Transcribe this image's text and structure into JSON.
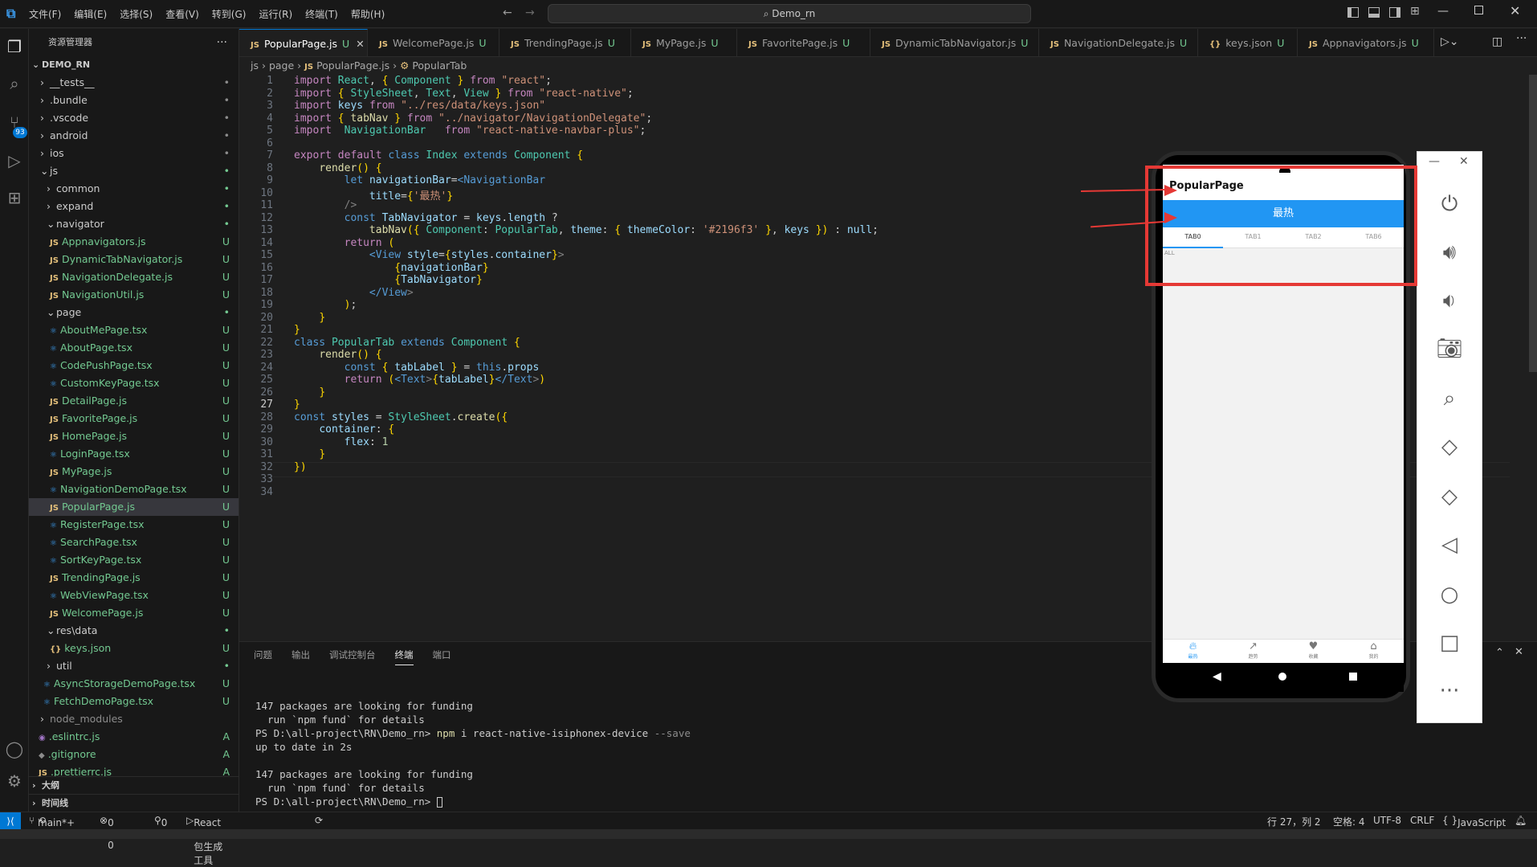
{
  "menu": [
    "文件(F)",
    "编辑(E)",
    "选择(S)",
    "查看(V)",
    "转到(G)",
    "运行(R)",
    "终端(T)",
    "帮助(H)"
  ],
  "search": {
    "text": "Demo_rn"
  },
  "sidebar": {
    "title": "资源管理器",
    "root": "DEMO_RN",
    "items": [
      {
        "label": "__tests__",
        "type": "folder",
        "status": "•"
      },
      {
        "label": ".bundle",
        "type": "folder",
        "status": "•"
      },
      {
        "label": ".vscode",
        "type": "folder",
        "status": "•"
      },
      {
        "label": "android",
        "type": "folder",
        "status": "•"
      },
      {
        "label": "ios",
        "type": "folder",
        "status": "•"
      },
      {
        "label": "js",
        "type": "folder-open",
        "status": "•"
      },
      {
        "label": "common",
        "type": "folder",
        "status": "•"
      },
      {
        "label": "expand",
        "type": "folder",
        "status": "•"
      },
      {
        "label": "navigator",
        "type": "folder-open",
        "status": "•"
      },
      {
        "label": "Appnavigators.js",
        "type": "js",
        "status": "U"
      },
      {
        "label": "DynamicTabNavigator.js",
        "type": "js",
        "status": "U"
      },
      {
        "label": "NavigationDelegate.js",
        "type": "js",
        "status": "U"
      },
      {
        "label": "NavigationUtil.js",
        "type": "js",
        "status": "U"
      },
      {
        "label": "page",
        "type": "folder-open",
        "status": "•"
      },
      {
        "label": "AboutMePage.tsx",
        "type": "tsx",
        "status": "U"
      },
      {
        "label": "AboutPage.tsx",
        "type": "tsx",
        "status": "U"
      },
      {
        "label": "CodePushPage.tsx",
        "type": "tsx",
        "status": "U"
      },
      {
        "label": "CustomKeyPage.tsx",
        "type": "tsx",
        "status": "U"
      },
      {
        "label": "DetailPage.js",
        "type": "js",
        "status": "U"
      },
      {
        "label": "FavoritePage.js",
        "type": "js",
        "status": "U"
      },
      {
        "label": "HomePage.js",
        "type": "js",
        "status": "U"
      },
      {
        "label": "LoginPage.tsx",
        "type": "tsx",
        "status": "U"
      },
      {
        "label": "MyPage.js",
        "type": "js",
        "status": "U"
      },
      {
        "label": "NavigationDemoPage.tsx",
        "type": "tsx",
        "status": "U"
      },
      {
        "label": "PopularPage.js",
        "type": "js",
        "status": "U"
      },
      {
        "label": "RegisterPage.tsx",
        "type": "tsx",
        "status": "U"
      },
      {
        "label": "SearchPage.tsx",
        "type": "tsx",
        "status": "U"
      },
      {
        "label": "SortKeyPage.tsx",
        "type": "tsx",
        "status": "U"
      },
      {
        "label": "TrendingPage.js",
        "type": "js",
        "status": "U"
      },
      {
        "label": "WebViewPage.tsx",
        "type": "tsx",
        "status": "U"
      },
      {
        "label": "WelcomePage.js",
        "type": "js",
        "status": "U"
      },
      {
        "label": "res\\data",
        "type": "folder-open",
        "status": "•"
      },
      {
        "label": "keys.json",
        "type": "json",
        "status": "U"
      },
      {
        "label": "util",
        "type": "folder",
        "status": "•"
      },
      {
        "label": "AsyncStorageDemoPage.tsx",
        "type": "tsx",
        "status": "U"
      },
      {
        "label": "FetchDemoPage.tsx",
        "type": "tsx",
        "status": "U"
      },
      {
        "label": "node_modules",
        "type": "folder",
        "status": ""
      },
      {
        "label": ".eslintrc.js",
        "type": "eslint",
        "status": "A"
      },
      {
        "label": ".gitignore",
        "type": "git",
        "status": "A"
      },
      {
        "label": ".prettierrc.js",
        "type": "prettier",
        "status": "A"
      }
    ],
    "outline": "大纲",
    "timeline": "时间线"
  },
  "tabs": [
    {
      "label": "PopularPage.js",
      "status": "U",
      "active": true
    },
    {
      "label": "WelcomePage.js",
      "status": "U"
    },
    {
      "label": "TrendingPage.js",
      "status": "U"
    },
    {
      "label": "MyPage.js",
      "status": "U"
    },
    {
      "label": "FavoritePage.js",
      "status": "U"
    },
    {
      "label": "DynamicTabNavigator.js",
      "status": "U"
    },
    {
      "label": "NavigationDelegate.js",
      "status": "U"
    },
    {
      "label": "keys.json",
      "status": "U"
    },
    {
      "label": "Appnavigators.js",
      "status": "U"
    }
  ],
  "breadcrumb": {
    "p1": "js",
    "p2": "page",
    "p3": "PopularPage.js",
    "p4": "PopularTab"
  },
  "code": [
    "import React, { Component } from \"react\";",
    "import { StyleSheet, Text, View } from \"react-native\";",
    "import keys from \"../res/data/keys.json\"",
    "import { tabNav } from \"../navigator/NavigationDelegate\";",
    "import  NavigationBar   from \"react-native-navbar-plus\";",
    "",
    "export default class Index extends Component {",
    "    render() {",
    "        let navigationBar=<NavigationBar",
    "            title={'最热'}",
    "        />",
    "        const TabNavigator = keys.length ?",
    "            tabNav({ Component: PopularTab, theme: { themeColor: '#2196f3' }, keys }) : null;",
    "        return (",
    "            <View style={styles.container}>",
    "                {navigationBar}",
    "                {TabNavigator}",
    "            </View>",
    "        );",
    "    }",
    "}",
    "class PopularTab extends Component {",
    "    render() {",
    "        const { tabLabel } = this.props",
    "        return (<Text>{tabLabel}</Text>)",
    "    }",
    "}",
    "const styles = StyleSheet.create({",
    "    container: {",
    "        flex: 1",
    "    }",
    "})",
    "",
    ""
  ],
  "panel": {
    "tabs": [
      "问题",
      "输出",
      "调试控制台",
      "终端",
      "端口"
    ],
    "active": "终端",
    "terminal": [
      "147 packages are looking for funding",
      "  run `npm fund` for details",
      "PS D:\\all-project\\RN\\Demo_rn> npm i react-native-isiphonex-device --save",
      "",
      "up to date in 2s",
      "",
      "147 packages are looking for funding",
      "  run `npm fund` for details",
      "PS D:\\all-project\\RN\\Demo_rn> "
    ]
  },
  "phone": {
    "header_title": "PopularPage",
    "navbar_title": "最热",
    "theme_color": "#2196f3",
    "tabs": [
      "TAB0",
      "TAB1",
      "TAB2",
      "TAB6"
    ],
    "content_label": "ALL",
    "bottom_tabs": [
      "最热",
      "趋势",
      "收藏",
      "我的"
    ]
  },
  "status": {
    "branch": "main*+",
    "problems": "0 △ 0",
    "ports": "0",
    "runner": "React Native 包生成工具",
    "position": "行 27，列 2",
    "spaces": "空格: 4",
    "encoding": "UTF-8",
    "eol": "CRLF",
    "language": "JavaScript"
  },
  "colors": {
    "accent": "#0078d4",
    "annotation": "#e53935",
    "phone_theme": "#2196f3"
  }
}
